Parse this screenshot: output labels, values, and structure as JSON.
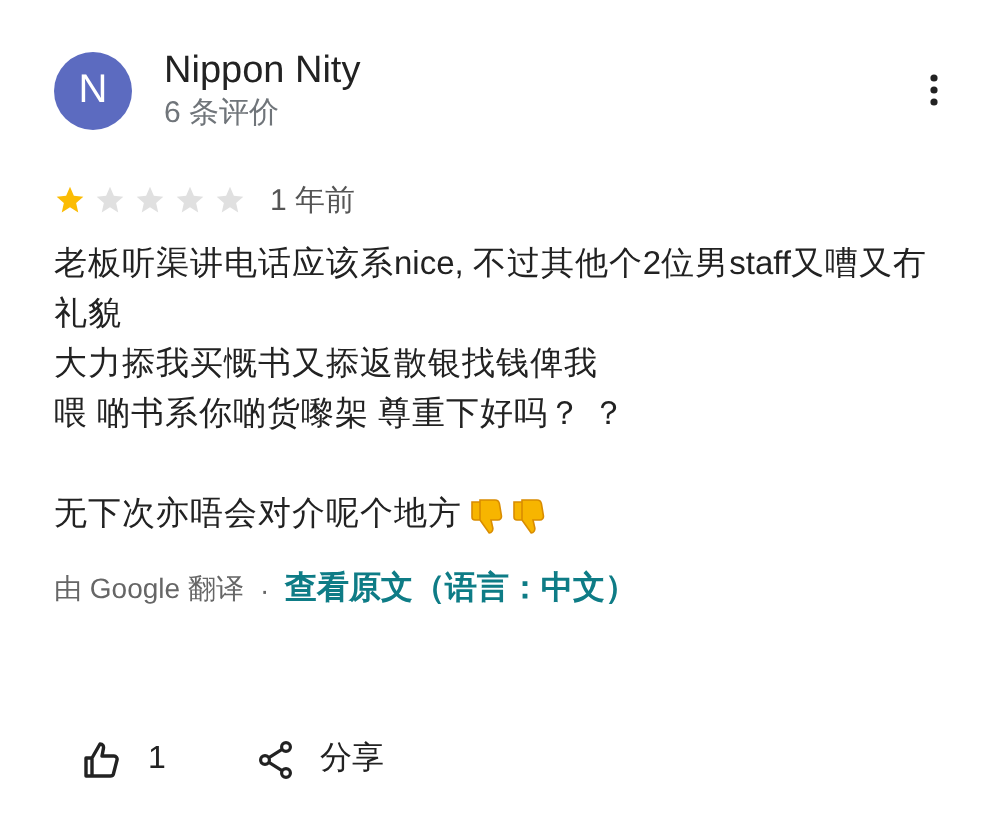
{
  "reviewer": {
    "initial": "N",
    "name": "Nippon Nity",
    "review_count": "6 条评价"
  },
  "rating": {
    "stars": 1,
    "time": "1 年前"
  },
  "body": {
    "paragraphs": [
      {
        "lines": [
          "老板听渠讲电话应该系nice, 不过其他个2位男staff又嘈又冇礼貌",
          "大力掭我买慨书又掭返散银找钱俾我",
          "喂 啲书系你啲货嚟架 尊重下好吗？ ？"
        ]
      },
      {
        "lines": [
          "无下次亦唔会对介呢个地方"
        ],
        "reactions": [
          {
            "kind": "thumbs-down"
          },
          {
            "kind": "thumbs-down"
          }
        ]
      }
    ]
  },
  "translation": {
    "note": "由 Google 翻译",
    "separator": "·",
    "link": "查看原文（语言：中文）"
  },
  "actions": [
    {
      "kind": "like",
      "label": "1"
    },
    {
      "kind": "share",
      "label": "分享"
    }
  ]
}
